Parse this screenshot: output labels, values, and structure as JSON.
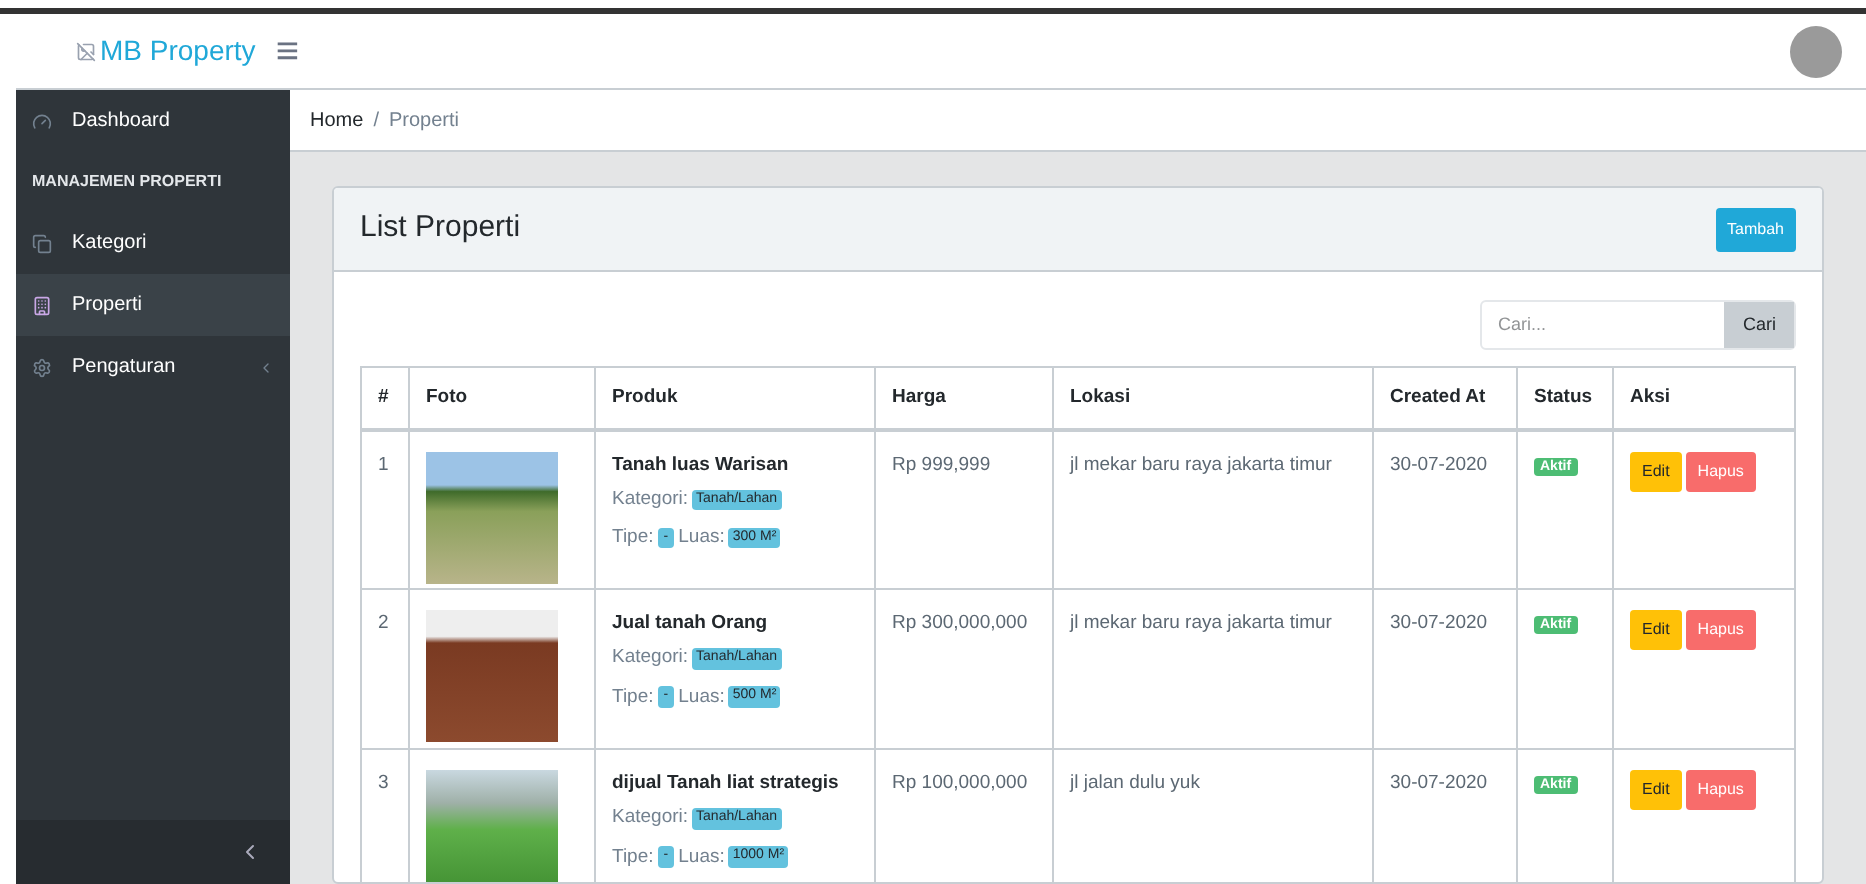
{
  "header": {
    "logo": "MB Property",
    "menu_icon": "≡"
  },
  "sidebar": {
    "items": [
      {
        "kind": "item",
        "label": "Dashboard",
        "selected": false,
        "has_submenu": false
      },
      {
        "kind": "section",
        "label": "MANAJEMEN PROPERTI"
      },
      {
        "kind": "item",
        "label": "Kategori",
        "selected": false,
        "has_submenu": false
      },
      {
        "kind": "item",
        "label": "Properti",
        "selected": true,
        "has_submenu": false
      },
      {
        "kind": "item",
        "label": "Pengaturan",
        "selected": false,
        "has_submenu": true
      }
    ]
  },
  "breadcrumb": {
    "separator": "/",
    "items": [
      {
        "label": "Home",
        "current": false
      },
      {
        "label": "Properti",
        "current": true
      }
    ]
  },
  "card": {
    "title": "List Properti",
    "add_button": "Tambah",
    "search": {
      "placeholder": "Cari...",
      "button": "Cari"
    }
  },
  "table": {
    "columns": [
      "#",
      "Foto",
      "Produk",
      "Harga",
      "Lokasi",
      "Created At",
      "Status",
      "Aksi"
    ],
    "rows": [
      {
        "no": "1",
        "name": "Tanah luas Warisan",
        "kategori_label": "Kategori:",
        "kategori": "Tanah/Lahan",
        "tipe_label": "Tipe:",
        "tipe": "-",
        "luas_label": "Luas:",
        "luas": "300 M²",
        "harga": "Rp 999,999",
        "lokasi": "jl mekar baru raya jakarta timur",
        "created": "30-07-2020",
        "status": "Aktif",
        "edit": "Edit",
        "hapus": "Hapus"
      },
      {
        "no": "2",
        "name": "Jual tanah Orang",
        "kategori_label": "Kategori:",
        "kategori": "Tanah/Lahan",
        "tipe_label": "Tipe:",
        "tipe": "-",
        "luas_label": "Luas:",
        "luas": "500 M²",
        "harga": "Rp 300,000,000",
        "lokasi": "jl mekar baru raya jakarta timur",
        "created": "30-07-2020",
        "status": "Aktif",
        "edit": "Edit",
        "hapus": "Hapus"
      },
      {
        "no": "3",
        "name": "dijual Tanah liat strategis",
        "kategori_label": "Kategori:",
        "kategori": "Tanah/Lahan",
        "tipe_label": "Tipe:",
        "tipe": "-",
        "luas_label": "Luas:",
        "luas": "1000 M²",
        "harga": "Rp 100,000,000",
        "lokasi": "jl jalan dulu yuk",
        "created": "30-07-2020",
        "status": "Aktif",
        "edit": "Edit",
        "hapus": "Hapus"
      }
    ]
  }
}
